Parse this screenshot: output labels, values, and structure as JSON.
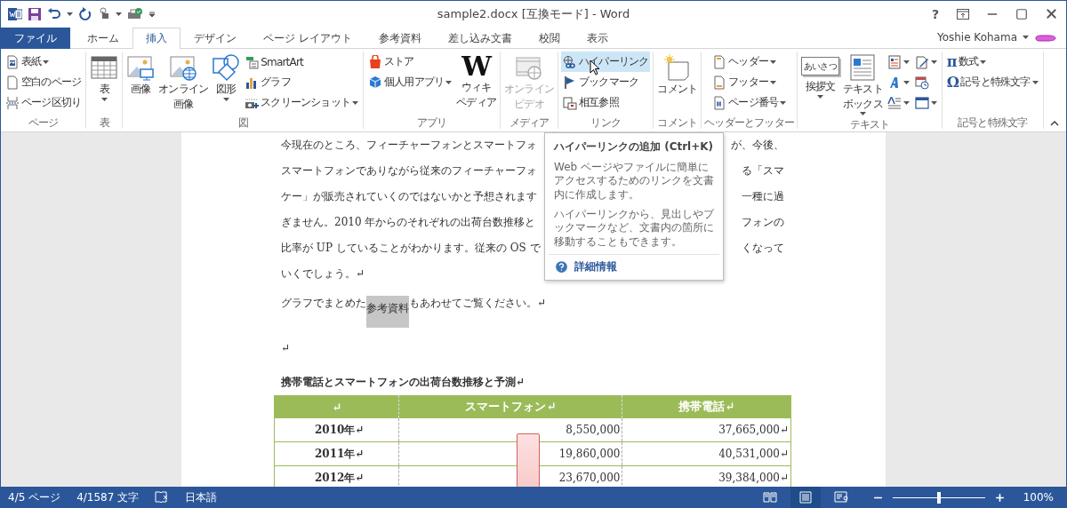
{
  "title_bar": {
    "title": "sample2.docx [互換モード] - Word",
    "help": "?"
  },
  "tabs": [
    {
      "label": "ファイル",
      "kind": "file",
      "selected": false
    },
    {
      "label": "ホーム",
      "kind": "tab",
      "selected": false
    },
    {
      "label": "挿入",
      "kind": "tab",
      "selected": true
    },
    {
      "label": "デザイン",
      "kind": "tab",
      "selected": false
    },
    {
      "label": "ページ レイアウト",
      "kind": "tab",
      "selected": false
    },
    {
      "label": "参考資料",
      "kind": "tab",
      "selected": false
    },
    {
      "label": "差し込み文書",
      "kind": "tab",
      "selected": false
    },
    {
      "label": "校閲",
      "kind": "tab",
      "selected": false
    },
    {
      "label": "表示",
      "kind": "tab",
      "selected": false
    }
  ],
  "user": {
    "name": "Yoshie Kohama"
  },
  "ribbon": {
    "groups": [
      {
        "label": "ページ",
        "items": [
          {
            "kind": "small",
            "label": "表紙",
            "dropdown": true
          },
          {
            "kind": "small",
            "label": "空白のページ",
            "dropdown": false
          },
          {
            "kind": "small",
            "label": "ページ区切り",
            "dropdown": false
          }
        ]
      },
      {
        "label": "表",
        "items": [
          {
            "kind": "large",
            "lines": [
              "表"
            ],
            "dropdown": true
          }
        ]
      },
      {
        "label": "図",
        "items": [
          {
            "kind": "large",
            "lines": [
              "画像"
            ],
            "dropdown": false
          },
          {
            "kind": "large",
            "lines": [
              "オンライン",
              "画像"
            ],
            "dropdown": false
          },
          {
            "kind": "large",
            "lines": [
              "図形"
            ],
            "dropdown": true
          },
          {
            "kind": "small",
            "label": "SmartArt",
            "dropdown": false
          },
          {
            "kind": "small",
            "label": "グラフ",
            "dropdown": false
          },
          {
            "kind": "small",
            "label": "スクリーンショット",
            "dropdown": true
          }
        ]
      },
      {
        "label": "アプリ",
        "items": [
          {
            "kind": "small",
            "label": "ストア",
            "dropdown": false
          },
          {
            "kind": "small",
            "label": "個人用アプリ",
            "dropdown": true
          },
          {
            "kind": "large",
            "glyph": "W",
            "lines": [
              "ウィキ",
              "ペディア"
            ],
            "dropdown": false
          }
        ]
      },
      {
        "label": "メディア",
        "items": [
          {
            "kind": "large",
            "lines": [
              "オンライン",
              "ビデオ"
            ],
            "dropdown": false,
            "disabled": true
          }
        ]
      },
      {
        "label": "リンク",
        "items": [
          {
            "kind": "small",
            "label": "ハイパーリンク",
            "dropdown": false,
            "highlighted": true
          },
          {
            "kind": "small",
            "label": "ブックマーク",
            "dropdown": false,
            "highlighted": false
          },
          {
            "kind": "small",
            "label": "相互参照",
            "dropdown": false,
            "highlighted": false
          }
        ]
      },
      {
        "label": "コメント",
        "items": [
          {
            "kind": "large",
            "lines": [
              "コメント"
            ],
            "dropdown": false
          }
        ]
      },
      {
        "label": "ヘッダーとフッター",
        "items": [
          {
            "kind": "small",
            "label": "ヘッダー",
            "dropdown": true
          },
          {
            "kind": "small",
            "label": "フッター",
            "dropdown": true
          },
          {
            "kind": "small",
            "label": "ページ番号",
            "dropdown": true
          }
        ]
      },
      {
        "label": "テキスト",
        "items": [
          {
            "kind": "large",
            "glyph": "あいさつ",
            "lines": [
              "挨拶文"
            ],
            "dropdown": true
          },
          {
            "kind": "large",
            "lines": [
              "テキスト",
              "ボックス"
            ],
            "dropdown": true
          },
          {
            "kind": "icon",
            "dropdown": true
          },
          {
            "kind": "icon",
            "dropdown": true
          },
          {
            "kind": "icon",
            "dropdown": true
          },
          {
            "kind": "icon",
            "dropdown": true
          },
          {
            "kind": "icon",
            "dropdown": false
          },
          {
            "kind": "icon",
            "dropdown": true
          }
        ]
      },
      {
        "label": "記号と特殊文字",
        "items": [
          {
            "kind": "small",
            "glyph": "π",
            "label": "数式",
            "dropdown": true
          },
          {
            "kind": "small",
            "glyph": "Ω",
            "label": "記号と特殊文字",
            "dropdown": true
          }
        ]
      }
    ]
  },
  "document": {
    "lines": [
      {
        "left": "今現在のところ、フィーチャーフォンとスマートフォ",
        "right": "が、今後、"
      },
      {
        "left": "スマートフォンでありながら従来のフィーチャーフォ",
        "right": "る「スマ"
      },
      {
        "left": "ケー」が販売されていくのではないかと予想されます",
        "right": "一種に過"
      },
      {
        "left": "ぎません。2010 年からのそれぞれの出荷台数推移と",
        "right": "フォンの"
      },
      {
        "left": "比率が UP していることがわかります。従来の OS で",
        "right": "くなって"
      },
      {
        "left": "いくでしょう。↵"
      }
    ],
    "paragraph": {
      "before": "グラフでまとめた",
      "highlight": "参考資料",
      "after": "もあわせてご覧ください。↵"
    },
    "empty_paragraph": "↵",
    "heading": "携帯電話とスマートフォンの出荷台数推移と予測↵",
    "table": {
      "columns": [
        "↵",
        "スマートフォン↵",
        "携帯電話↵"
      ],
      "rows": [
        [
          "2010年↵",
          "8,550,000",
          "37,665,000↵"
        ],
        [
          "2011年↵",
          "19,860,000",
          "40,531,000↵"
        ],
        [
          "2012年↵",
          "23,670,000",
          "39,384,000↵"
        ]
      ]
    }
  },
  "tooltip": {
    "title": "ハイパーリンクの追加 (Ctrl+K)",
    "paragraphs": [
      "Web ページやファイルに簡単にアクセスするためのリンクを文書内に作成します。",
      "ハイパーリンクから、見出しやブックマークなど、文書内の箇所に移動することもできます。"
    ],
    "link": "詳細情報"
  },
  "status_bar": {
    "items": [
      "4/5 ページ",
      "4/1587 文字"
    ],
    "language": "日本語",
    "views": [
      {
        "selected": false
      },
      {
        "selected": true
      },
      {
        "selected": false
      }
    ],
    "zoom": {
      "level": 0.5,
      "label": "100%"
    }
  }
}
